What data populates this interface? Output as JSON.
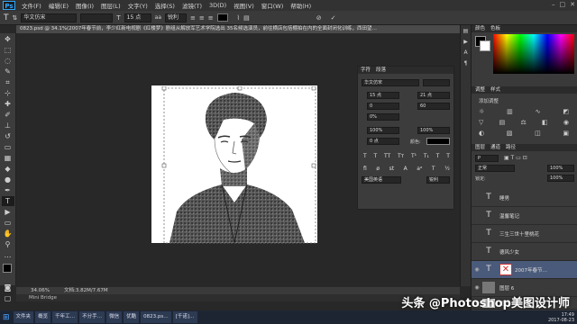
{
  "app": {
    "logo": "Ps"
  },
  "menu": [
    "文件(F)",
    "编辑(E)",
    "图像(I)",
    "图层(L)",
    "文字(Y)",
    "选择(S)",
    "滤镜(T)",
    "3D(D)",
    "视图(V)",
    "窗口(W)",
    "帮助(H)"
  ],
  "options": {
    "font_family": "华文仿宋",
    "font_size": "15 点",
    "anti_alias": "锐利"
  },
  "doc_tab": "0823.psd @ 34.1%(2007年春节前，李少红新电视剧《红楼梦》剧组从解放军艺术学院选出 35名候选演员，前往横店包括棚拍在内的全面封闭化训练，西田望…",
  "char_panel": {
    "tabs": [
      "字符",
      "段落"
    ],
    "font": "华文仿宋",
    "size": "15 点",
    "leading": "21 点",
    "kerning": "0",
    "tracking": "60",
    "scale_pct": "0%",
    "vscale": "100%",
    "hscale": "100%",
    "baseline": "0 点",
    "color_label": "颜色:",
    "language": "美国英语",
    "aa": "锐利"
  },
  "right_panels": {
    "color_tabs": [
      "颜色",
      "色板"
    ],
    "adjust_tabs": [
      "调整",
      "样式"
    ],
    "adjust_label": "添加调整",
    "layers_tabs": [
      "图层",
      "通道",
      "路径"
    ],
    "blend_mode": "正常",
    "opacity": "100%",
    "fill": "100%",
    "lock_label": "锁定:",
    "layers": [
      {
        "name": "睡男",
        "type": "text"
      },
      {
        "name": "温馨笔记",
        "type": "text"
      },
      {
        "name": "三生三世十里桃花",
        "type": "text"
      },
      {
        "name": "德风少女",
        "type": "text"
      },
      {
        "name": "2007年春节…",
        "type": "text"
      },
      {
        "name": "图层 6",
        "type": "image"
      },
      {
        "name": "图层 2",
        "type": "image"
      }
    ]
  },
  "status": {
    "zoom": "34.06%",
    "doc": "文档:3.82M/7.67M"
  },
  "mini_bridge": "Mini Bridge",
  "taskbar": [
    "文件夹",
    "概览",
    "千年工…",
    "不分手…",
    "微信",
    "优酷",
    "0823.ps…",
    "[千诺]…"
  ],
  "watermark": "头条 @Photoshop美图设计师",
  "clock": {
    "time": "17:49",
    "date": "2017-08-23"
  }
}
